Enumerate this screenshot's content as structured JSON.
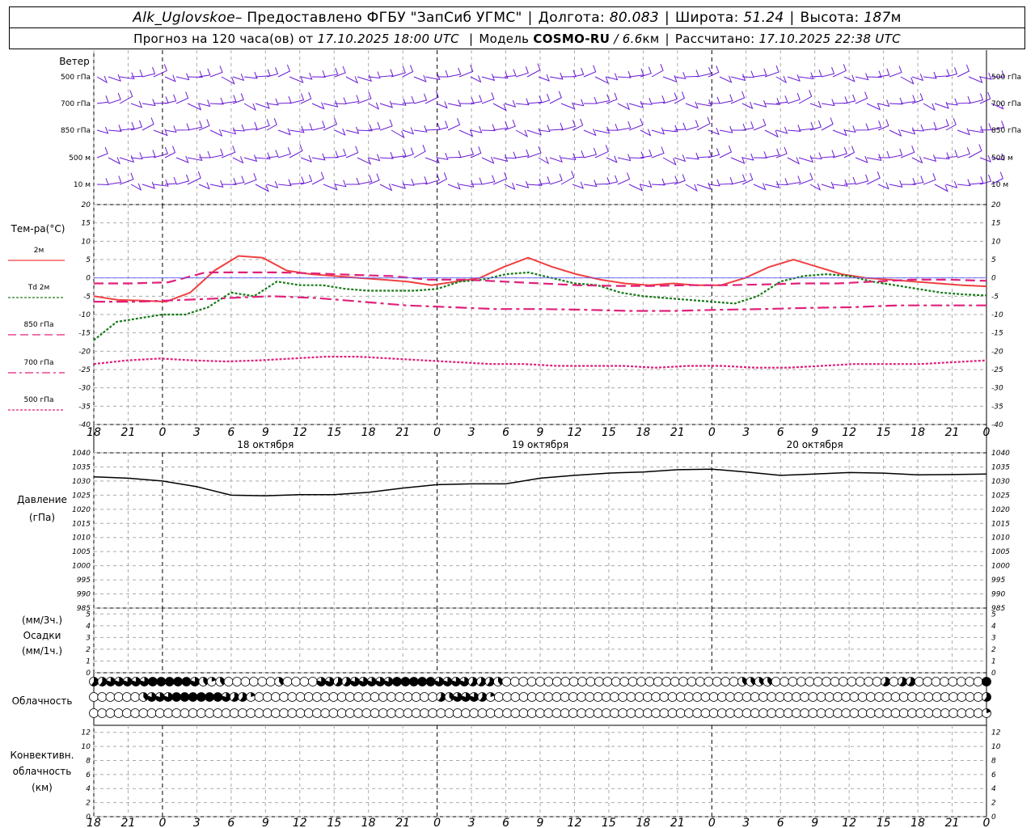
{
  "header": {
    "station": "Alk_Uglovskoe",
    "provider": " – Предоставлено ФГБУ \"ЗапСиб УГМС\"",
    "lon_label": "Долгота:",
    "lon_value": "80.083",
    "lat_label": "Широта:",
    "lat_value": "51.24",
    "alt_label": "Высота:",
    "alt_value": "187",
    "alt_unit": "м",
    "forecast_prefix": "Прогноз на 120 часа(ов) от",
    "forecast_start": "17.10.2025 18:00 UTC",
    "model_label": "Модель",
    "model_name": "COSMO-RU",
    "model_res_value": "/ 6.6",
    "model_res_unit": "км",
    "computed_label": "Рассчитано:",
    "computed_value": "17.10.2025 22:38 UTC"
  },
  "wind_panel": {
    "title": "Ветер",
    "levels": [
      "500 гПа",
      "700 гПа",
      "850 гПа",
      "500 м",
      "10 м"
    ],
    "color": "#6a1bd6"
  },
  "temp_panel": {
    "title": "Тем-ра(°C)",
    "yticks": [
      20,
      15,
      10,
      5,
      0,
      -5,
      -10,
      -15,
      -20,
      -25,
      -30,
      -35,
      -40
    ],
    "legend": [
      {
        "label": "2м",
        "color": "#f04040",
        "style": "solid"
      },
      {
        "label": "Td  2м",
        "color": "#1a7a1a",
        "style": "dotted"
      },
      {
        "label": "850 гПа",
        "color": "#e0207a",
        "style": "dashed"
      },
      {
        "label": "700 гПа",
        "color": "#e0207a",
        "style": "dashdot"
      },
      {
        "label": "500 гПа",
        "color": "#e0207a",
        "style": "dotted"
      }
    ]
  },
  "pressure_panel": {
    "title_line1": "Давление",
    "title_line2": "(гПа)",
    "yticks": [
      1040,
      1035,
      1030,
      1025,
      1020,
      1015,
      1010,
      1005,
      1000,
      995,
      990,
      985
    ]
  },
  "precip_panel": {
    "unit_top": "(мм/3ч.)",
    "title": "Осадки",
    "unit_bottom": "(мм/1ч.)",
    "yticks": [
      5,
      4,
      3,
      2,
      1,
      0
    ]
  },
  "cloud_panel": {
    "title": "Облачность"
  },
  "conv_panel": {
    "title_line1": "Конвективн.",
    "title_line2": "облачность",
    "title_line3": "(км)",
    "yticks": [
      12,
      10,
      8,
      6,
      4,
      2,
      0
    ]
  },
  "time_axis": {
    "labels": [
      "18",
      "21",
      "0",
      "3",
      "6",
      "9",
      "12",
      "15",
      "18",
      "21",
      "0",
      "3",
      "6",
      "9",
      "12",
      "15",
      "18",
      "21",
      "0",
      "3",
      "6",
      "9",
      "12",
      "15",
      "18",
      "21",
      "0"
    ],
    "dates": [
      "18 октября",
      "19 октября",
      "20 октября"
    ]
  },
  "chart_data": {
    "type": "line",
    "x_hours": [
      0,
      3,
      6,
      9,
      12,
      15,
      18,
      21,
      24,
      27,
      30,
      33,
      36,
      39,
      42,
      45,
      48,
      51,
      54,
      57,
      60,
      63,
      66,
      69,
      72,
      75,
      78
    ],
    "series": [
      {
        "name": "2м",
        "values": [
          -5,
          -6,
          -6.2,
          -6.5,
          -4,
          2,
          6,
          5.5,
          2,
          1,
          0.5,
          0,
          -0.5,
          -1,
          -2,
          -1,
          0,
          3,
          5.5,
          3,
          1,
          -0.5,
          -1.5,
          -2,
          -1.5,
          -2,
          -2,
          0,
          3,
          5,
          3,
          1,
          0,
          -0.5,
          -1,
          -1.5,
          -2,
          -2.3
        ]
      },
      {
        "name": "Td  2м",
        "values": [
          -17,
          -12,
          -11,
          -10,
          -10,
          -8,
          -4,
          -5,
          -1,
          -2,
          -2,
          -3,
          -3.5,
          -3.5,
          -3.5,
          -3,
          -1,
          -0.5,
          1,
          1.5,
          0,
          -1.5,
          -2,
          -4,
          -5,
          -5.5,
          -6,
          -6.5,
          -7,
          -5,
          -1,
          0.5,
          1,
          0.5,
          -1,
          -2,
          -3,
          -4,
          -4.5,
          -4.8
        ]
      },
      {
        "name": "850 гПа",
        "values": [
          -1.5,
          -1.5,
          -1.2,
          1.5,
          1.5,
          1.5,
          1.2,
          0.8,
          0.5,
          -0.5,
          -0.5,
          -1,
          -1.5,
          -2,
          -2.2,
          -2.2,
          -2,
          -2,
          -1.8,
          -1.5,
          -1.5,
          -1,
          -0.5,
          -0.5,
          -0.8
        ]
      },
      {
        "name": "700 гПа",
        "values": [
          -6.5,
          -6.5,
          -6,
          -5.5,
          -5,
          -5.5,
          -6.5,
          -7.5,
          -8,
          -8.5,
          -8.5,
          -8.7,
          -9,
          -9,
          -8.7,
          -8.5,
          -8.2,
          -8,
          -7.5,
          -7.5,
          -7.5
        ]
      },
      {
        "name": "500 гПа",
        "values": [
          -23.5,
          -22.5,
          -22,
          -22.5,
          -22.8,
          -22.5,
          -22,
          -21.5,
          -21.5,
          -22,
          -22.5,
          -23,
          -23.5,
          -23.5,
          -24,
          -24,
          -24,
          -24.5,
          -24,
          -24,
          -24.5,
          -24.5,
          -24,
          -23.5,
          -23.5,
          -23.5,
          -23,
          -22.5
        ]
      },
      {
        "name": "Давление",
        "values": [
          1031.5,
          1031,
          1030,
          1028,
          1025,
          1024.8,
          1025.2,
          1025.2,
          1026,
          1027.5,
          1028.7,
          1029,
          1029,
          1031,
          1032,
          1032.8,
          1033.2,
          1034,
          1034.2,
          1033.2,
          1032,
          1032.5,
          1033,
          1032.8,
          1032.2,
          1032.3,
          1032.5
        ]
      }
    ],
    "ylim_temp": [
      -40,
      20
    ],
    "ylim_pressure": [
      985,
      1040
    ],
    "ylim_precip": [
      0,
      5
    ],
    "ylim_conv": [
      0,
      13
    ],
    "precip_values": [],
    "cloud_rows": {
      "upper": "3 3 4 4 4 4 4 5 5 5 5 5 4 2 1 2 0 0 0 0 0 0 2 0 0 0 0 4 4 3 3 4 4 4 4 4 5 5 5 5 5 4 4 4 4 3 3 3 2 0 0 0 0 0 0 0 0 0 0 0 0 0 0 0 0 0 0 0 0 0 0 0 0 0 0 0 0 2 2 2 2 0 0 0 0 0 0 0 0 0 0 0 0 0 3 0 3 3 0 0 0 0 0 0 0 0 5",
      "middle": "0 0 0 0 0 0 2 4 4 4 5 5 5 5 5 5 4 3 3 1 0 0 0 0 0 0 0 0 0 0 0 0 0 0 0 0 0 0 0 0 0 0 3 2 4 4 4 3 1 0 0 0 0 0 0 0 0 0 0 0 0 0 0 0 0 0 0 0 0 0 0 0 0 0 0 0 0 0 0 0 0 0 0 0 0 0 0 0 0 0 0 0 0 0 0 0 0 0 0 0 0 0 0 0 0 0 0 0 3",
      "lower": "0 0 0 0 0 0 0 0 0 0 0 0 0 0 0 0 0 0 0 0 0 0 0 0 0 0 0 0 0 0 0 0 0 0 0 0 0 0 0 0 0 0 0 0 0 0 0 0 0 0 0 0 0 0 0 0 0 0 0 0 0 0 0 0 0 0 0 0 0 0 0 0 0 0 0 0 0 0 0 0 0 0 0 0 0 0 0 0 0 0 0 0 0 0 0 0 0 0 0 0 0 0 0 0 0 0 0 0 1"
    }
  }
}
